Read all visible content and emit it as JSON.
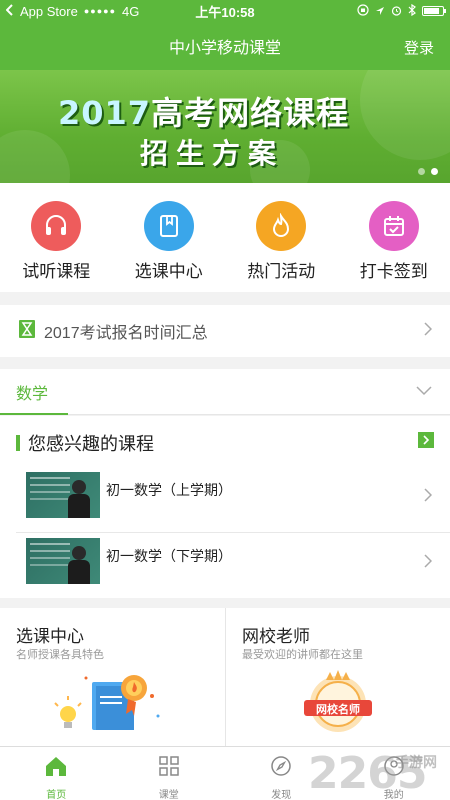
{
  "status_bar": {
    "carrier": "App Store",
    "signal": "●●●●●",
    "network": "4G",
    "time": "上午10:58",
    "battery_level": 0.85
  },
  "navbar": {
    "title": "中小学移动课堂",
    "login_label": "登录"
  },
  "banner": {
    "year": "2017",
    "headline": "高考网络课程",
    "subline": "招生方案",
    "slide_count": 2,
    "active_slide": 2
  },
  "quick_menu": {
    "items": [
      {
        "label": "试听课程",
        "icon": "headphones-icon",
        "color": "#ee5c5c"
      },
      {
        "label": "选课中心",
        "icon": "book-icon",
        "color": "#3aa6ea"
      },
      {
        "label": "热门活动",
        "icon": "flame-icon",
        "color": "#f5a623"
      },
      {
        "label": "打卡签到",
        "icon": "calendar-check-icon",
        "color": "#e45fc4"
      }
    ]
  },
  "exam_notice": {
    "label": "2017考试报名时间汇总",
    "icon": "hourglass-icon"
  },
  "subject_selector": {
    "selected": "数学",
    "icon": "chevron-down-icon"
  },
  "interest": {
    "heading": "您感兴趣的课程",
    "courses": [
      {
        "title": "初一数学（上学期）"
      },
      {
        "title": "初一数学（下学期）"
      }
    ]
  },
  "feature_cards": [
    {
      "title": "选课中心",
      "subtitle": "名师授课各具特色"
    },
    {
      "title": "网校老师",
      "subtitle": "最受欢迎的讲师都在这里",
      "badge_text": "网校名师"
    }
  ],
  "tabbar": {
    "tabs": [
      {
        "label": "首页",
        "icon": "home-icon",
        "active": true
      },
      {
        "label": "课堂",
        "icon": "grid-icon",
        "active": false
      },
      {
        "label": "发现",
        "icon": "compass-icon",
        "active": false
      },
      {
        "label": "我的",
        "icon": "user-icon",
        "active": false
      }
    ]
  },
  "watermark": {
    "number": "2265",
    "text": "手游网"
  },
  "colors": {
    "brand_green": "#5cb83c"
  }
}
